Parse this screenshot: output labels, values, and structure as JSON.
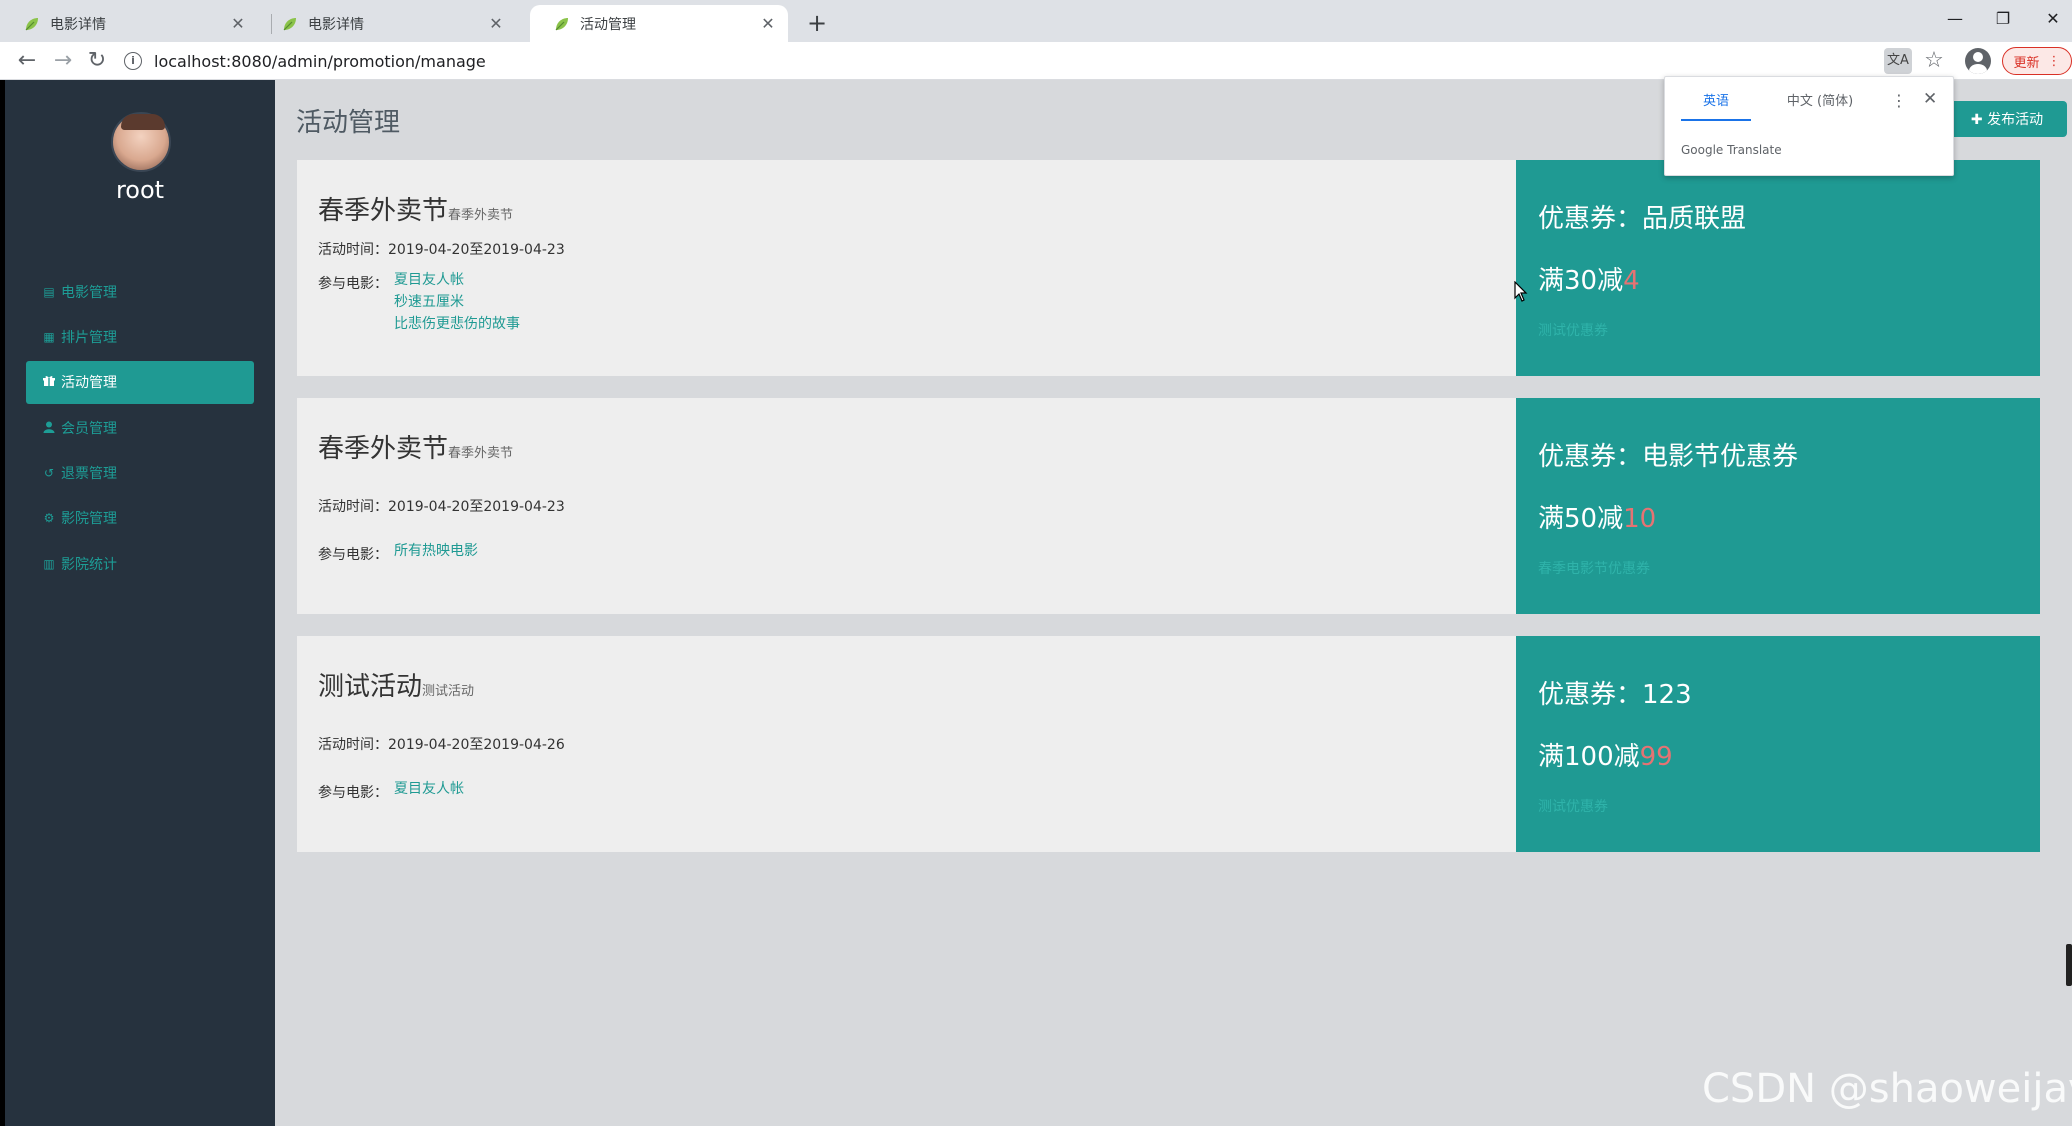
{
  "browser": {
    "tabs": [
      {
        "title": "电影详情",
        "close": "✕",
        "active": false
      },
      {
        "title": "电影详情",
        "close": "✕",
        "active": false
      },
      {
        "title": "活动管理",
        "close": "✕",
        "active": true
      }
    ],
    "new_tab": "+",
    "window_controls": {
      "minimize": "—",
      "maximize": "❐",
      "close": "✕"
    },
    "url": "localhost:8080/admin/promotion/manage",
    "update_label": "更新",
    "colors": {
      "accent": "#1a73e8",
      "update": "#d93025"
    }
  },
  "sidebar": {
    "username": "root",
    "items": [
      {
        "label": "电影管理",
        "icon": "film-icon",
        "glyph": "▤",
        "active": false
      },
      {
        "label": "排片管理",
        "icon": "calendar-icon",
        "glyph": "▦",
        "active": false
      },
      {
        "label": "活动管理",
        "icon": "gift-icon",
        "glyph": "🎁",
        "active": true
      },
      {
        "label": "会员管理",
        "icon": "user-icon",
        "glyph": "👤",
        "active": false
      },
      {
        "label": "退票管理",
        "icon": "refund-icon",
        "glyph": "↺",
        "active": false
      },
      {
        "label": "影院管理",
        "icon": "gears-icon",
        "glyph": "⚙",
        "active": false
      },
      {
        "label": "影院统计",
        "icon": "chart-icon",
        "glyph": "▥",
        "active": false
      }
    ]
  },
  "main": {
    "title": "活动管理",
    "publish_button": "✚ 发布活动",
    "time_label": "活动时间：",
    "movie_label": "参与电影：",
    "coupon_prefix": "优惠券：",
    "promotions": [
      {
        "name": "春季外卖节",
        "subtitle": "春季外卖节",
        "time": "2019-04-20至2019-04-23",
        "movies": [
          "夏目友人帐",
          "秒速五厘米",
          "比悲伤更悲伤的故事"
        ],
        "coupon_name": "品质联盟",
        "rule_prefix": "满30减",
        "discount": "4",
        "coupon_desc": "测试优惠券"
      },
      {
        "name": "春季外卖节",
        "subtitle": "春季外卖节",
        "time": "2019-04-20至2019-04-23",
        "movies": [
          "所有热映电影"
        ],
        "coupon_name": "电影节优惠券",
        "rule_prefix": "满50减",
        "discount": "10",
        "coupon_desc": "春季电影节优惠券"
      },
      {
        "name": "测试活动",
        "subtitle": "测试活动",
        "time": "2019-04-20至2019-04-26",
        "movies": [
          "夏目友人帐"
        ],
        "coupon_name": "123",
        "rule_prefix": "满100减",
        "discount": "99",
        "coupon_desc": "测试优惠券"
      }
    ],
    "colors": {
      "teal": "#1f9a93",
      "sidebar": "#26323e",
      "discount": "#e57373"
    }
  },
  "translate_popup": {
    "tab_source": "英语",
    "tab_target": "中文 (简体)",
    "more": "⋮",
    "close": "✕",
    "brand": "Google Translate"
  },
  "watermark": "CSDN @shaoweijava"
}
